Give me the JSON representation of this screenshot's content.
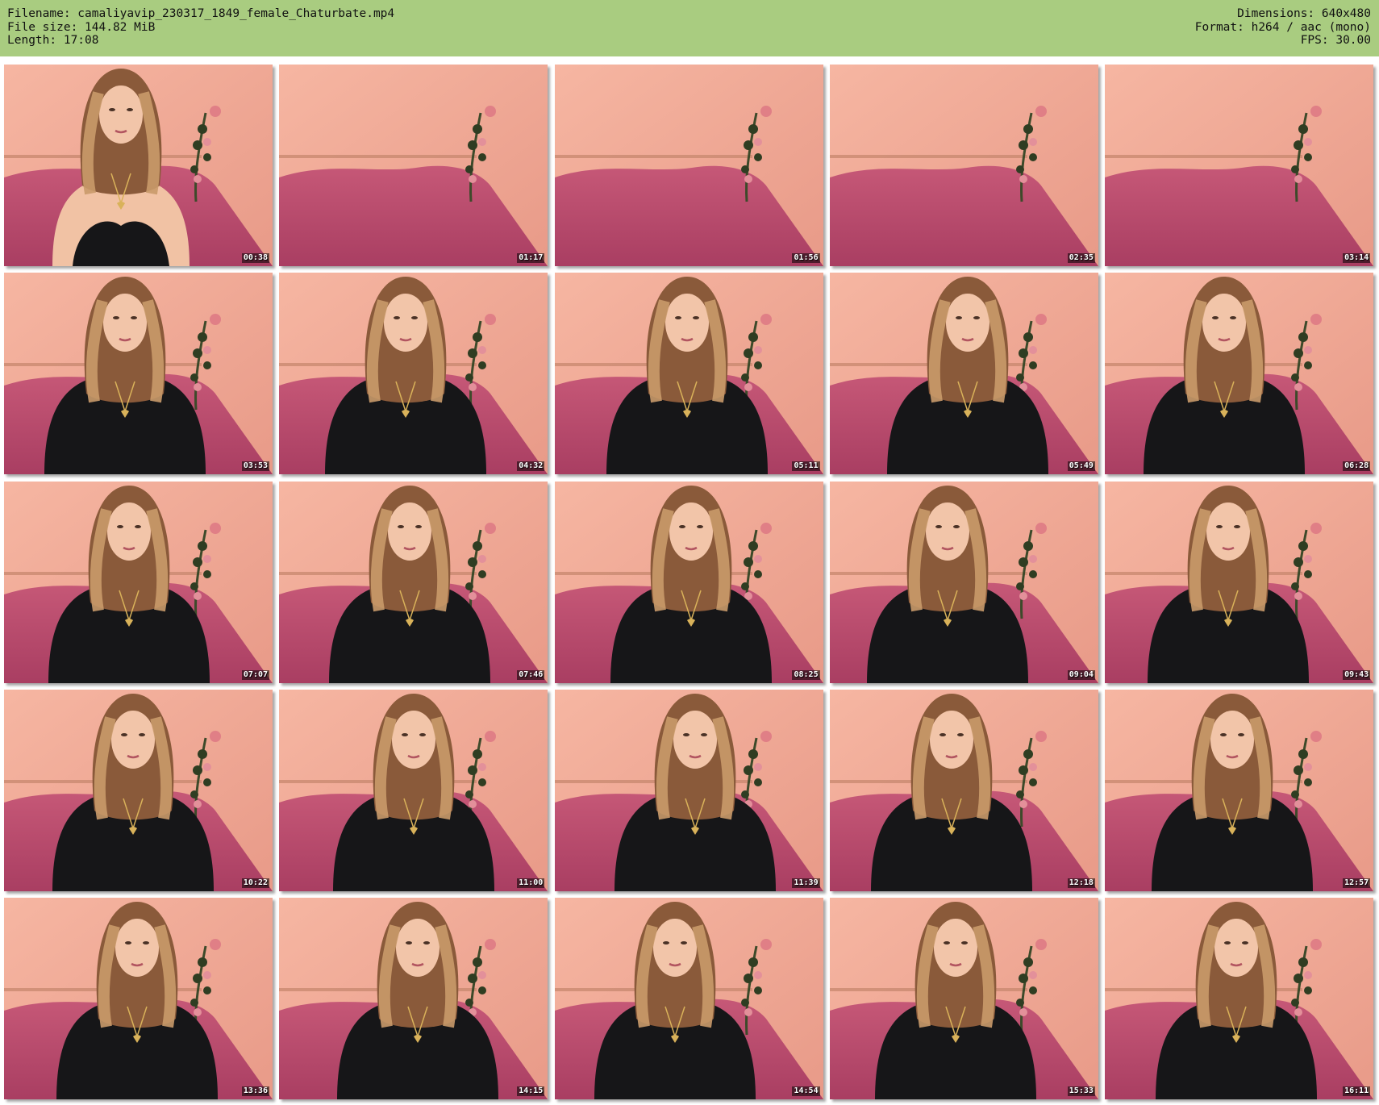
{
  "header": {
    "filename_line": "Filename: camaliyavip_230317_1849_female_Chaturbate.mp4",
    "filesize_line": "File size: 144.82 MiB",
    "length_line": "Length: 17:08",
    "dimensions_line": "Dimensions: 640x480",
    "format_line": "Format: h264 / aac (mono)",
    "fps_line": "FPS: 30.00"
  },
  "colors": {
    "header_background": "#a9cc80",
    "wall": "#f2a894",
    "bed": "#b84a6a",
    "shirt": "#161618",
    "hair": "#8a5a3a"
  },
  "thumbnails": [
    {
      "time": "00:38",
      "person": true,
      "outfit": "black-top"
    },
    {
      "time": "01:17",
      "person": false
    },
    {
      "time": "01:56",
      "person": false
    },
    {
      "time": "02:35",
      "person": false
    },
    {
      "time": "03:14",
      "person": false
    },
    {
      "time": "03:53",
      "person": true,
      "outfit": "black-tshirt"
    },
    {
      "time": "04:32",
      "person": true,
      "outfit": "black-tshirt"
    },
    {
      "time": "05:11",
      "person": true,
      "outfit": "black-tshirt"
    },
    {
      "time": "05:49",
      "person": true,
      "outfit": "black-tshirt"
    },
    {
      "time": "06:28",
      "person": true,
      "outfit": "black-tshirt"
    },
    {
      "time": "07:07",
      "person": true,
      "outfit": "black-tshirt"
    },
    {
      "time": "07:46",
      "person": true,
      "outfit": "black-tshirt"
    },
    {
      "time": "08:25",
      "person": true,
      "outfit": "black-tshirt"
    },
    {
      "time": "09:04",
      "person": true,
      "outfit": "black-tshirt"
    },
    {
      "time": "09:43",
      "person": true,
      "outfit": "black-tshirt"
    },
    {
      "time": "10:22",
      "person": true,
      "outfit": "black-tshirt"
    },
    {
      "time": "11:00",
      "person": true,
      "outfit": "black-tshirt"
    },
    {
      "time": "11:39",
      "person": true,
      "outfit": "black-tshirt"
    },
    {
      "time": "12:18",
      "person": true,
      "outfit": "black-tshirt"
    },
    {
      "time": "12:57",
      "person": true,
      "outfit": "black-tshirt"
    },
    {
      "time": "13:36",
      "person": true,
      "outfit": "black-tshirt"
    },
    {
      "time": "14:15",
      "person": true,
      "outfit": "black-tshirt"
    },
    {
      "time": "14:54",
      "person": true,
      "outfit": "black-tshirt"
    },
    {
      "time": "15:33",
      "person": true,
      "outfit": "black-tshirt"
    },
    {
      "time": "16:11",
      "person": true,
      "outfit": "black-tshirt"
    }
  ]
}
